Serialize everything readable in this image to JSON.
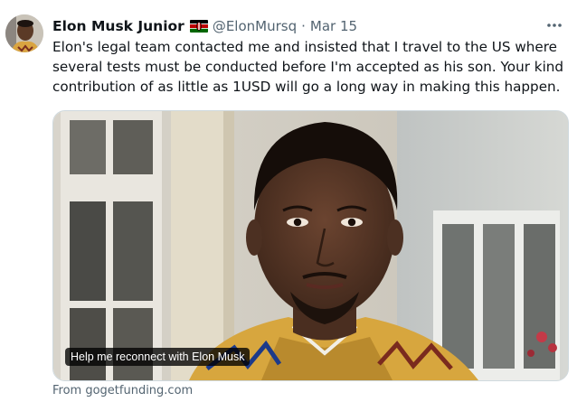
{
  "tweet": {
    "display_name": "Elon Musk Junior",
    "handle": "@ElonMursq",
    "separator": "·",
    "date": "Mar 15",
    "text_lines": [
      "Elon's legal team contacted me and insisted that I travel to the US where",
      "several tests must be conducted before I'm accepted as his son. Your kind",
      "contribution of as little as 1USD will go a long way in making this happen."
    ],
    "media_caption": "Help me reconnect with Elon Musk",
    "source": "From gogetfunding.com"
  },
  "icons": {
    "avatar": "avatar",
    "flag": "kenya-flag-icon",
    "more": "more-options-icon"
  },
  "colors": {
    "text": "#0f1419",
    "secondary": "#536471",
    "flag_black": "#000000",
    "flag_red": "#bb0000",
    "flag_green": "#006600"
  }
}
